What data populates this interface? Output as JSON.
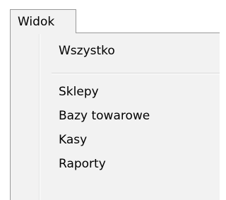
{
  "menu_bar": {
    "active_menu_label": "Widok"
  },
  "dropdown": {
    "items": [
      {
        "label": "Wszystko"
      },
      {
        "label": "Sklepy"
      },
      {
        "label": "Bazy towarowe"
      },
      {
        "label": "Kasy"
      },
      {
        "label": "Raporty"
      }
    ]
  }
}
